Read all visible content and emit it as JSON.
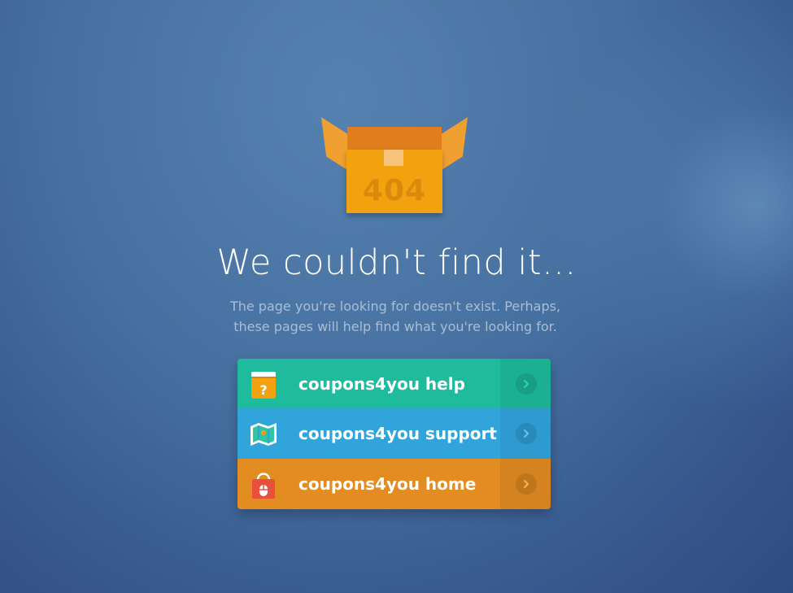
{
  "error_box": {
    "code": "404"
  },
  "heading": "We couldn't find it...",
  "description": {
    "line1": "The page you're looking for doesn't exist. Perhaps,",
    "line2": "these pages will help find what you're looking for."
  },
  "links": [
    {
      "label": "coupons4you help",
      "icon": "help-book-icon",
      "color": "#1ebc9c"
    },
    {
      "label": "coupons4you support",
      "icon": "map-icon",
      "color": "#31a4dc"
    },
    {
      "label": "coupons4you home",
      "icon": "shopping-bag-icon",
      "color": "#e38c22"
    }
  ]
}
